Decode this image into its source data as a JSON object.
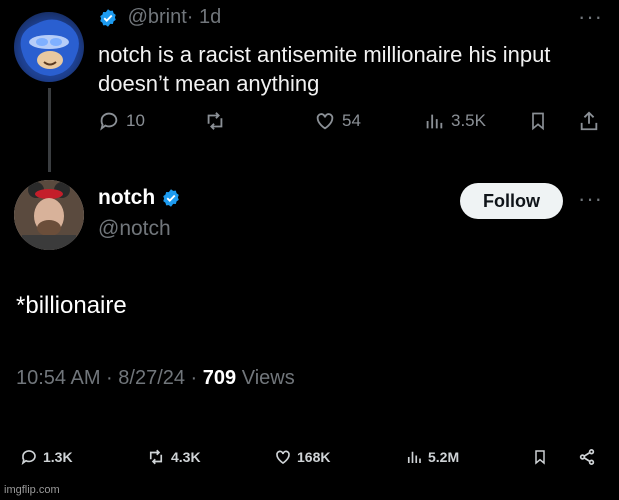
{
  "reply_tweet": {
    "handle": "@brint",
    "time": "· 1d",
    "text": "notch is a racist antisemite millionaire his input doesn’t mean anything",
    "more": "···",
    "stats": {
      "replies": "10",
      "likes": "54",
      "views": "3.5K"
    }
  },
  "main_tweet": {
    "display_name": "notch",
    "handle": "@notch",
    "follow_label": "Follow",
    "more": "···",
    "text": "*billionaire",
    "timestamp": "10:54 AM · 8/27/24 · ",
    "views_count": "709",
    "views_label": " Views",
    "stats": {
      "replies": "1.3K",
      "reposts": "4.3K",
      "likes": "168K",
      "views": "5.2M"
    }
  },
  "watermark": "imgflip.com",
  "colors": {
    "verified": "#1d9bf0",
    "background": "#000000",
    "muted": "#71767b"
  },
  "icons": [
    "verified-badge",
    "reply-icon",
    "repost-icon",
    "like-icon",
    "views-icon",
    "bookmark-icon",
    "share-icon"
  ]
}
